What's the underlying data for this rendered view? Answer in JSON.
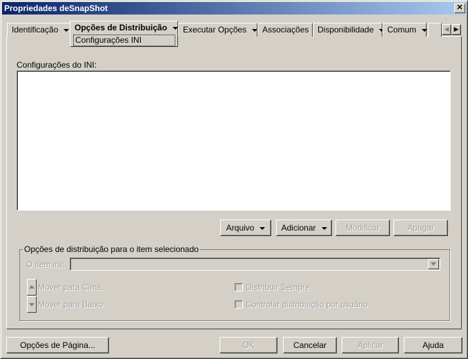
{
  "window": {
    "title": "Propriedades deSnapShot",
    "close_icon": "close-icon"
  },
  "tabs": [
    {
      "label": "Identificação",
      "has_menu": true
    },
    {
      "label": "Opções de Distribuição",
      "has_menu": true,
      "active": true,
      "subpage": "Configurações INI"
    },
    {
      "label": "Executar Opções",
      "has_menu": true
    },
    {
      "label": "Associações",
      "has_menu": false
    },
    {
      "label": "Disponibilidade",
      "has_menu": true
    },
    {
      "label": "Comum",
      "has_menu": true
    }
  ],
  "ini": {
    "label": "Configurações do INI:",
    "items": []
  },
  "actions": {
    "file": "Arquivo",
    "add": "Adicionar",
    "modify": "Modificar",
    "delete": "Apagar"
  },
  "group": {
    "title": "Opções de distribuição para o item selecionado",
    "item_label": "O item irá:",
    "item_value": "",
    "move_up": "Mover para Cima",
    "move_down": "Mover para Baixo",
    "always": "Distribuir Sempre",
    "per_user": "Controlar distribuição por usuário"
  },
  "footer": {
    "page_options": "Opções de Página...",
    "ok": "OK",
    "cancel": "Cancelar",
    "apply": "Aplicar",
    "help": "Ajuda"
  }
}
